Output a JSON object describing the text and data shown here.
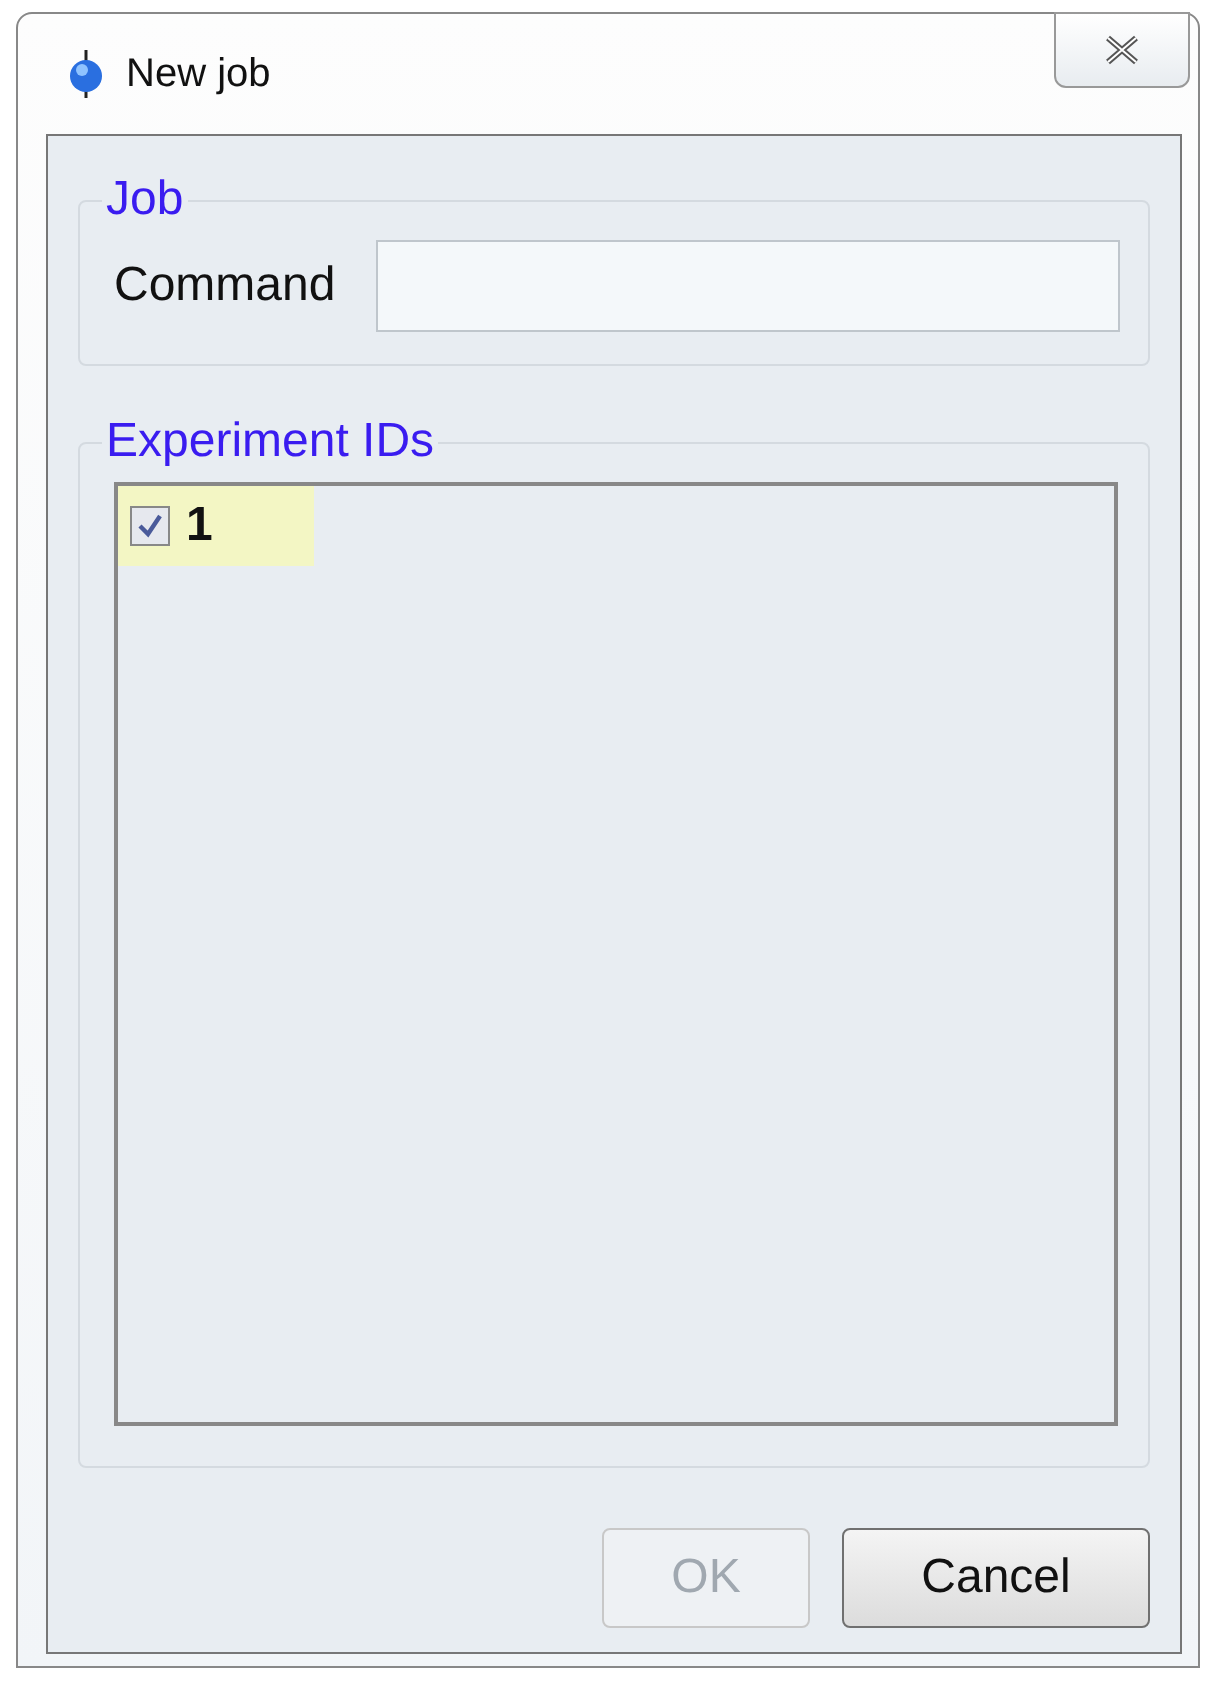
{
  "window": {
    "title": "New job"
  },
  "job": {
    "legend": "Job",
    "command_label": "Command"
  },
  "experiments": {
    "legend": "Experiment IDs",
    "items": [
      {
        "label": "1",
        "checked": true,
        "selected": true
      }
    ]
  },
  "buttons": [
    {
      "label": "OK",
      "disabled": true
    },
    {
      "label": "Cancel",
      "disabled": false
    }
  ]
}
